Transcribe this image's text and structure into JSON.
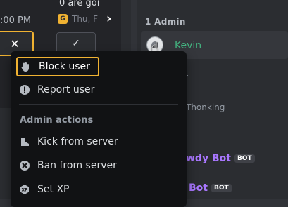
{
  "left_panel": {
    "time_text": ":00 PM",
    "preview_text": "0 are goi",
    "date_text": "Thu, F",
    "date_icon_glyph": "G",
    "decline_glyph": "✕",
    "accept_glyph": "✓",
    "chevron_glyph": "›"
  },
  "member_list": {
    "role_header": "1 Admin",
    "member_name": "Kevin",
    "partial_letter": "r",
    "status_text": "Thonking",
    "bots": [
      {
        "name": "wdy Bot",
        "tag": "BOT"
      },
      {
        "name": "Bot",
        "tag": "BOT"
      }
    ]
  },
  "context_menu": {
    "items": [
      {
        "label": "Block user",
        "icon": "hand-stop-icon",
        "focused": true
      },
      {
        "label": "Report user",
        "icon": "report-alert-icon",
        "focused": false
      }
    ],
    "section_label": "Admin actions",
    "admin_items": [
      {
        "label": "Kick from server",
        "icon": "kick-boot-icon"
      },
      {
        "label": "Ban from server",
        "icon": "ban-x-icon"
      },
      {
        "label": "Set XP",
        "icon": "xp-badge-icon"
      }
    ]
  },
  "colors": {
    "focus_ring": "#f0b232",
    "admin_name": "#43b581",
    "bot_name": "#a977ff",
    "menu_bg": "#111214"
  }
}
